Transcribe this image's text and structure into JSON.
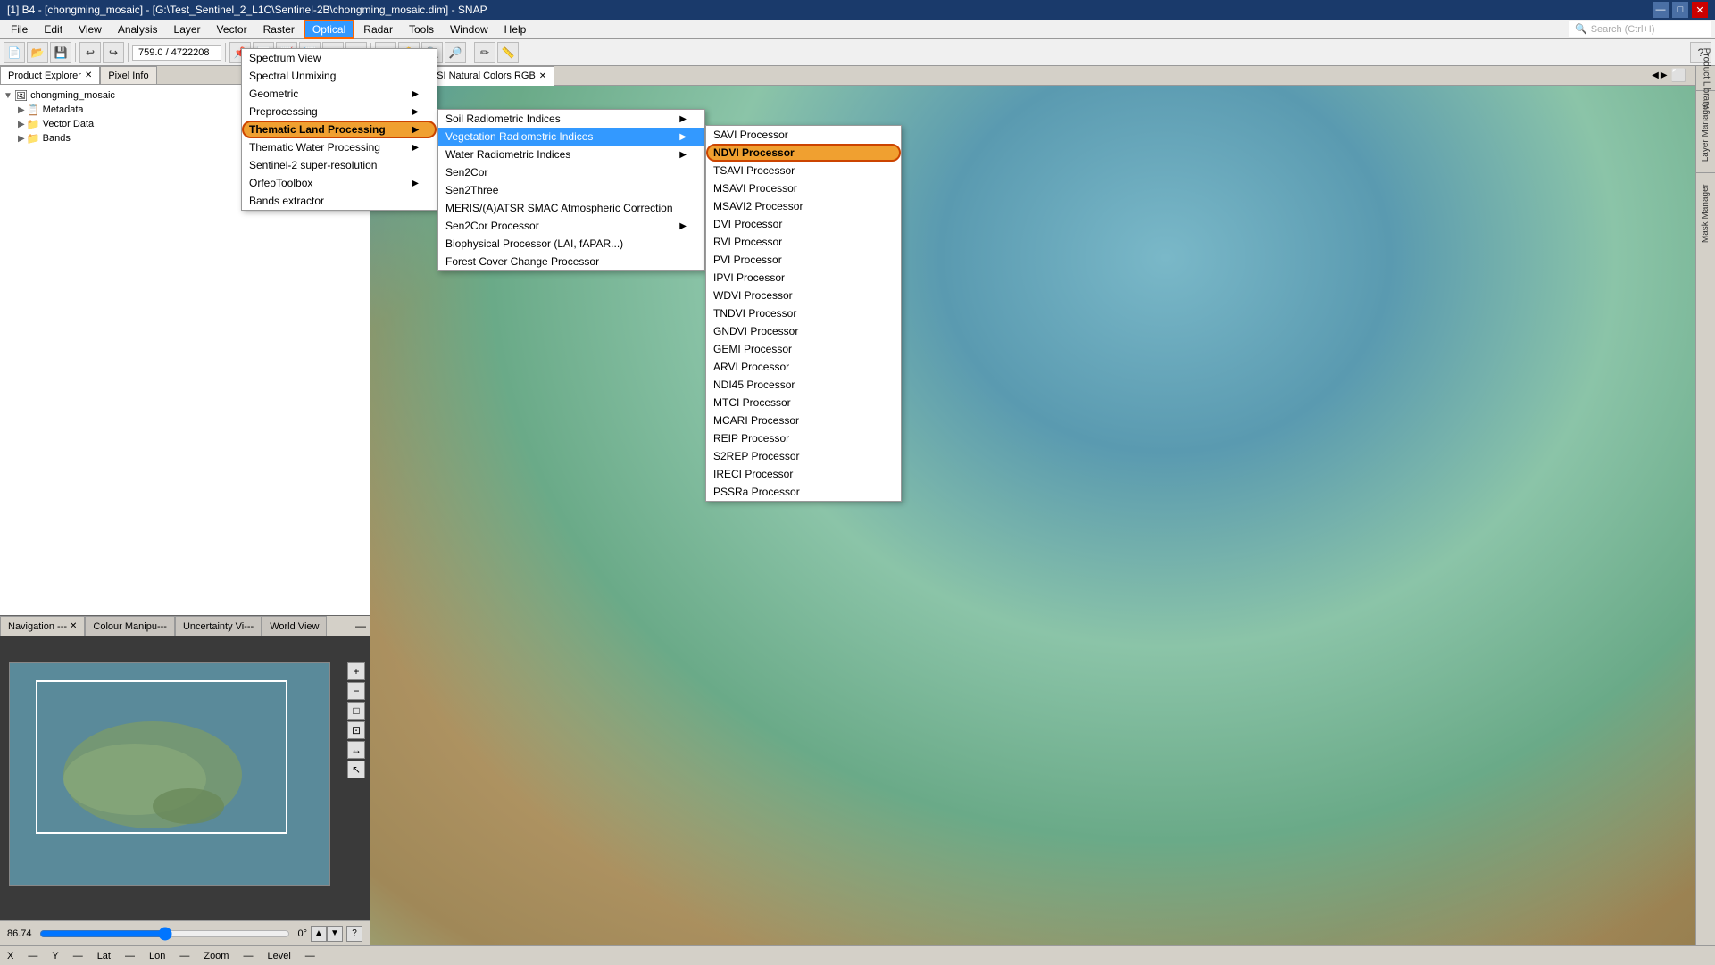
{
  "titlebar": {
    "title": "[1] B4 - [chongming_mosaic] - [G:\\Test_Sentinel_2_L1C\\Sentinel-2B\\chongming_mosaic.dim] - SNAP",
    "min": "—",
    "max": "□",
    "close": "✕"
  },
  "menubar": {
    "items": [
      "File",
      "Edit",
      "View",
      "Analysis",
      "Layer",
      "Vector",
      "Raster",
      "Optical",
      "Radar",
      "Tools",
      "Window",
      "Help"
    ]
  },
  "toolbar": {
    "coord": "759.0 / 4722208",
    "search_placeholder": "Search (Ctrl+I)"
  },
  "product_explorer": {
    "tabs": [
      "Product Explorer",
      "Pixel Info"
    ],
    "tree": {
      "root": "chongming_mosaic",
      "children": [
        "Metadata",
        "Vector Data",
        "Bands"
      ]
    }
  },
  "image_tabs": {
    "items": [
      "Sentinel 2 MSI Natural Colors RGB"
    ]
  },
  "nav_panel": {
    "tabs": [
      "Navigation ---",
      "Colour Manipu---",
      "Uncertainty Vi---",
      "World View"
    ],
    "zoom_label": "86.74",
    "angle_label": "0°"
  },
  "status_bar": {
    "x_label": "X",
    "x_sep": "—",
    "y_label": "Y",
    "y_sep": "—",
    "lat_label": "Lat",
    "lat_sep": "—",
    "lon_label": "Lon",
    "lon_sep": "—",
    "zoom_label": "Zoom",
    "zoom_sep": "—",
    "level_label": "Level",
    "level_sep": "—"
  },
  "optical_menu": {
    "items": [
      {
        "label": "Spectrum View",
        "has_sub": false
      },
      {
        "label": "Spectral Unmixing",
        "has_sub": false
      },
      {
        "label": "Geometric",
        "has_sub": true
      },
      {
        "label": "Preprocessing",
        "has_sub": true
      },
      {
        "label": "Thematic Land Processing",
        "has_sub": true,
        "highlighted": true
      },
      {
        "label": "Thematic Water Processing",
        "has_sub": true
      },
      {
        "label": "Sentinel-2 super-resolution",
        "has_sub": false
      },
      {
        "label": "OrfeoToolbox",
        "has_sub": true
      },
      {
        "label": "Bands extractor",
        "has_sub": false
      }
    ]
  },
  "thematic_menu": {
    "items": [
      {
        "label": "Soil Radiometric Indices",
        "has_sub": true
      },
      {
        "label": "Vegetation Radiometric Indices",
        "has_sub": true,
        "highlighted": true
      },
      {
        "label": "Water Radiometric Indices",
        "has_sub": true
      },
      {
        "label": "Sen2Cor",
        "has_sub": false
      },
      {
        "label": "Sen2Three",
        "has_sub": false
      },
      {
        "label": "MERIS/(A)ATSR SMAC Atmospheric Correction",
        "has_sub": false
      },
      {
        "label": "Sen2Cor Processor",
        "has_sub": true
      },
      {
        "label": "Biophysical Processor (LAI, fAPAR...)",
        "has_sub": false
      },
      {
        "label": "Forest Cover Change Processor",
        "has_sub": false
      }
    ]
  },
  "vegetation_menu": {
    "items": [
      {
        "label": "SAVI Processor",
        "has_sub": false
      },
      {
        "label": "NDVI Processor",
        "has_sub": false,
        "highlighted": true
      },
      {
        "label": "TSAVI Processor",
        "has_sub": false
      },
      {
        "label": "MSAVI Processor",
        "has_sub": false
      },
      {
        "label": "MSAVI2 Processor",
        "has_sub": false
      },
      {
        "label": "DVI Processor",
        "has_sub": false
      },
      {
        "label": "RVI Processor",
        "has_sub": false
      },
      {
        "label": "PVI Processor",
        "has_sub": false
      },
      {
        "label": "IPVI Processor",
        "has_sub": false
      },
      {
        "label": "WDVI Processor",
        "has_sub": false
      },
      {
        "label": "TNDVI Processor",
        "has_sub": false
      },
      {
        "label": "GNDVI Processor",
        "has_sub": false
      },
      {
        "label": "GEMI Processor",
        "has_sub": false
      },
      {
        "label": "ARVI Processor",
        "has_sub": false
      },
      {
        "label": "NDI45 Processor",
        "has_sub": false
      },
      {
        "label": "MTCI Processor",
        "has_sub": false
      },
      {
        "label": "MCARI Processor",
        "has_sub": false
      },
      {
        "label": "REIP Processor",
        "has_sub": false
      },
      {
        "label": "S2REP Processor",
        "has_sub": false
      },
      {
        "label": "IRECI Processor",
        "has_sub": false
      },
      {
        "label": "PSSRa Processor",
        "has_sub": false
      }
    ]
  },
  "right_panel": {
    "labels": [
      "Layer Manager",
      "Mask Manager"
    ]
  }
}
